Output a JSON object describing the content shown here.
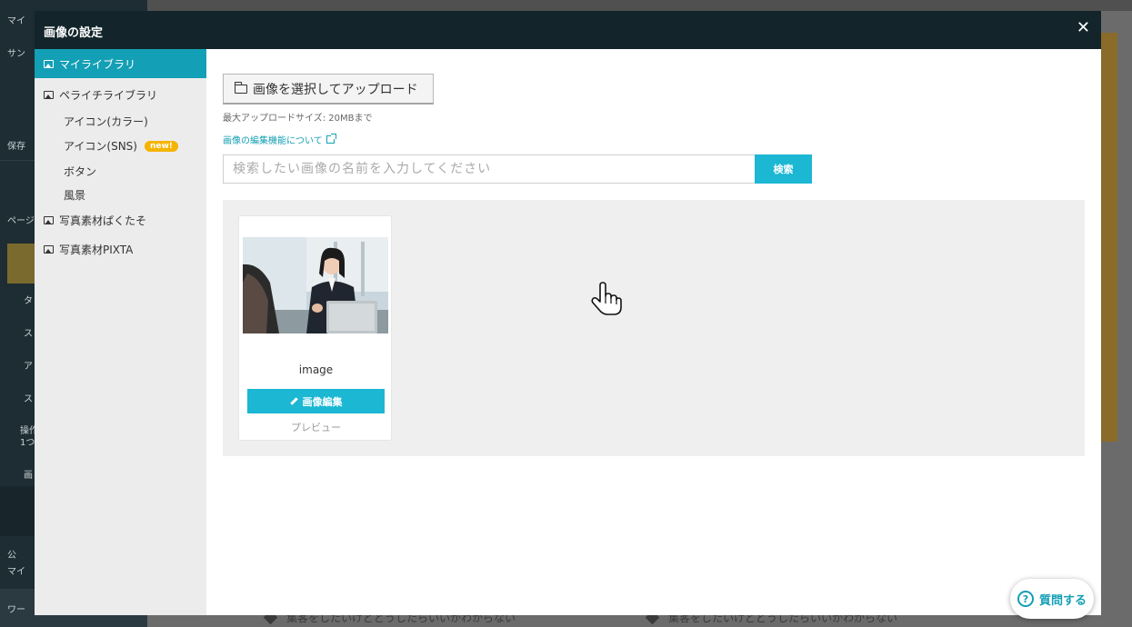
{
  "background": {
    "left_texts": [
      "マイ",
      "サン",
      "保存",
      "ページ",
      "タ",
      "ス",
      "ア",
      "ス",
      "操作",
      "1つ",
      "画",
      "公",
      "マイ",
      "ワー"
    ],
    "bottom_texts": [
      "集客をしたいけどどうしたらいいかわからない",
      "集客をしたいけどどうしたらいいかわからない"
    ]
  },
  "modal": {
    "title": "画像の設定",
    "close_icon": "close-icon"
  },
  "sidebar": {
    "items": [
      {
        "label": "マイライブラリ",
        "icon": "image-icon",
        "active": true
      },
      {
        "label": "ペライチライブラリ",
        "icon": "image-icon",
        "active": false
      },
      {
        "label": "写真素材ぱくたそ",
        "icon": "image-icon",
        "active": false
      },
      {
        "label": "写真素材PIXTA",
        "icon": "image-icon",
        "active": false
      }
    ],
    "subitems": [
      {
        "label": "アイコン(カラー)"
      },
      {
        "label": "アイコン(SNS)",
        "badge": "new!"
      },
      {
        "label": "ボタン"
      },
      {
        "label": "風景"
      }
    ]
  },
  "content": {
    "upload_label": "画像を選択してアップロード",
    "upload_note": "最大アップロードサイズ: 20MBまで",
    "edit_link": "画像の編集機能について",
    "search_placeholder": "検索したい画像の名前を入力してください",
    "search_label": "検索"
  },
  "gallery": {
    "items": [
      {
        "name": "image",
        "edit_label": "画像編集",
        "preview_label": "プレビュー"
      }
    ]
  },
  "help": {
    "label": "質問する"
  },
  "colors": {
    "accent": "#139fb5",
    "button": "#1bb7d3",
    "header": "#13252b",
    "badge": "#f5b400"
  }
}
